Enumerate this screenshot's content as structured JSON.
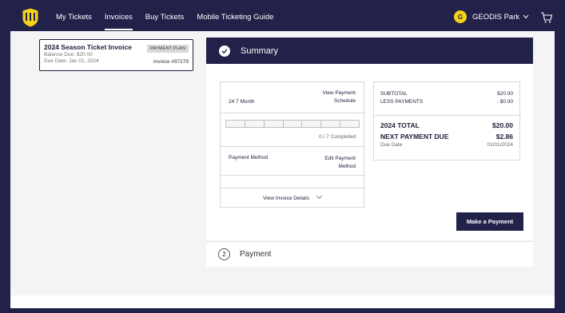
{
  "nav": {
    "items": [
      {
        "label": "My Tickets",
        "active": false
      },
      {
        "label": "Invoices",
        "active": true
      },
      {
        "label": "Buy Tickets",
        "active": false
      },
      {
        "label": "Mobile Ticketing Guide",
        "active": false
      }
    ],
    "venue": {
      "initial": "G",
      "label": "GEODIS Park",
      "chevron": "chevron-down-icon"
    },
    "cart_icon": "cart-icon",
    "logo": "nashville-sc-logo"
  },
  "invoice_card": {
    "title": "2024 Season Ticket Invoice",
    "badge": "PAYMENT PLAN",
    "balance": "Balance Due: $20.00",
    "due": "Due Date: Jan 01, 2024",
    "number": "Invoice #97279"
  },
  "summary": {
    "header": "Summary",
    "check_icon": "check-icon",
    "schedule": {
      "term": "24 7 Month",
      "view_schedule": [
        "View Payment",
        "Schedule"
      ],
      "segments": 7,
      "completed_count": 0,
      "completed_text": "0 / 7 Completed",
      "payment_method_label": "Payment Method",
      "edit_method": [
        "Edit Payment",
        "Method"
      ],
      "view_details": "View Invoice Details"
    },
    "totals": {
      "subtotal_label": "SUBTOTAL",
      "subtotal_value": "$20.00",
      "less_label": "LESS PAYMENTS",
      "less_value": "- $0.00",
      "total_label": "2024 TOTAL",
      "total_value": "$20.00",
      "next_label": "NEXT PAYMENT DUE",
      "next_value": "$2.86",
      "due_label": "Due Date",
      "due_value": "01/01/2024"
    },
    "pay_button": "Make a Payment"
  },
  "payment_step": {
    "number": "2",
    "label": "Payment"
  },
  "colors": {
    "navy": "#22214a",
    "gold": "#f3d21a",
    "panel_bg": "#f4f4f5"
  }
}
